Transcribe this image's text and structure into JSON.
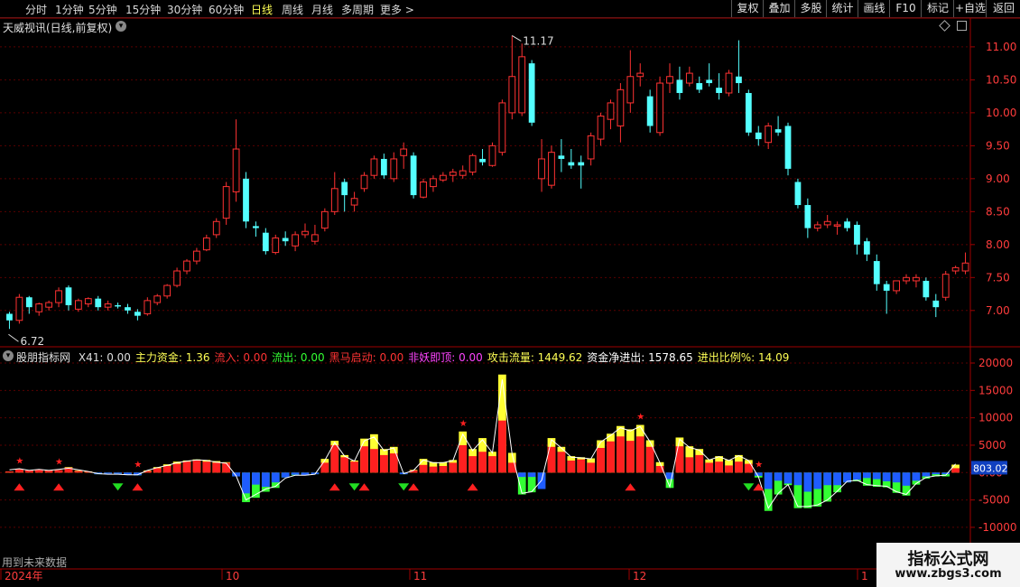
{
  "toolbar": {
    "left_items": [
      "分时",
      "1分钟",
      "5分钟",
      "15分钟",
      "30分钟",
      "60分钟",
      "日线",
      "周线",
      "月线",
      "多周期",
      "更多 >"
    ],
    "active_item": "日线",
    "right_buttons": [
      "复权",
      "叠加",
      "多股",
      "统计",
      "画线",
      "F10",
      "标记",
      "+自选",
      "返回"
    ]
  },
  "main_chart": {
    "title": "天威视讯(日线,前复权)",
    "high_label": "11.17",
    "low_label": "6.72",
    "y_axis": {
      "ticks": [
        11.0,
        10.5,
        10.0,
        9.5,
        9.0,
        8.5,
        8.0,
        7.5,
        7.0
      ]
    }
  },
  "indicator": {
    "name": "股朋指标网",
    "fields": [
      {
        "label": "X41:",
        "value": "0.00",
        "color": "#dddddd"
      },
      {
        "label": "主力资金:",
        "value": "1.36",
        "color": "#ffff55"
      },
      {
        "label": "流入:",
        "value": "0.00",
        "color": "#ff3333"
      },
      {
        "label": "流出:",
        "value": "0.00",
        "color": "#33ff33"
      },
      {
        "label": "黑马启动:",
        "value": "0.00",
        "color": "#ff3333"
      },
      {
        "label": "非妖即顶:",
        "value": "0.00",
        "color": "#ff44ff"
      },
      {
        "label": "攻击流量:",
        "value": "1449.62",
        "color": "#ffff55"
      },
      {
        "label": "资金净进出:",
        "value": "1578.65",
        "color": "#ffffff"
      },
      {
        "label": "进出比例%:",
        "value": "14.09",
        "color": "#ffff55"
      }
    ],
    "y_axis": {
      "ticks": [
        "20000",
        "15000",
        "10000",
        "5000",
        "0.00",
        "-5000",
        "-10000"
      ]
    },
    "current_value": "803.02"
  },
  "x_axis": {
    "labels": [
      "2024年",
      "10",
      "11",
      "12",
      "1"
    ]
  },
  "future_note": "用到未来数据",
  "watermark": {
    "title": "指标公式网",
    "url": "www.zbgs3.com"
  },
  "colors": {
    "up": "#ff3232",
    "down": "#54ffff",
    "grid": "#5a0000",
    "axis": "#a00000"
  },
  "chart_data": [
    {
      "type": "candlestick",
      "title": "天威视讯(日线,前复权)",
      "ylim": [
        6.6,
        11.3
      ],
      "ohlc": [
        [
          6.95,
          6.98,
          6.72,
          6.85
        ],
        [
          6.85,
          7.25,
          6.8,
          7.2
        ],
        [
          7.2,
          7.22,
          6.95,
          7.05
        ],
        [
          6.98,
          7.12,
          6.92,
          7.1
        ],
        [
          7.05,
          7.15,
          7.0,
          7.12
        ],
        [
          7.12,
          7.35,
          7.05,
          7.3
        ],
        [
          7.35,
          7.38,
          7.0,
          7.08
        ],
        [
          7.02,
          7.18,
          6.98,
          7.15
        ],
        [
          7.1,
          7.2,
          7.05,
          7.18
        ],
        [
          7.18,
          7.22,
          7.0,
          7.05
        ],
        [
          7.05,
          7.15,
          7.0,
          7.1
        ],
        [
          7.08,
          7.12,
          7.03,
          7.06
        ],
        [
          7.05,
          7.1,
          6.95,
          7.0
        ],
        [
          6.98,
          7.02,
          6.85,
          6.92
        ],
        [
          6.95,
          7.2,
          6.92,
          7.15
        ],
        [
          7.12,
          7.25,
          7.08,
          7.22
        ],
        [
          7.22,
          7.4,
          7.18,
          7.38
        ],
        [
          7.38,
          7.65,
          7.35,
          7.6
        ],
        [
          7.6,
          7.78,
          7.55,
          7.75
        ],
        [
          7.75,
          7.95,
          7.7,
          7.9
        ],
        [
          7.92,
          8.15,
          7.9,
          8.1
        ],
        [
          8.15,
          8.4,
          8.1,
          8.35
        ],
        [
          8.4,
          8.95,
          8.3,
          8.88
        ],
        [
          8.8,
          9.9,
          8.65,
          9.45
        ],
        [
          9.0,
          9.1,
          8.25,
          8.35
        ],
        [
          8.28,
          8.35,
          8.12,
          8.25
        ],
        [
          8.18,
          8.25,
          7.85,
          7.9
        ],
        [
          7.88,
          8.15,
          7.85,
          8.1
        ],
        [
          8.1,
          8.2,
          7.98,
          8.05
        ],
        [
          7.98,
          8.2,
          7.9,
          8.15
        ],
        [
          8.15,
          8.32,
          8.1,
          8.2
        ],
        [
          8.05,
          8.3,
          8.0,
          8.15
        ],
        [
          8.25,
          8.55,
          8.2,
          8.5
        ],
        [
          8.5,
          9.1,
          8.45,
          8.85
        ],
        [
          8.95,
          9.0,
          8.5,
          8.75
        ],
        [
          8.6,
          8.8,
          8.5,
          8.7
        ],
        [
          8.85,
          9.1,
          8.8,
          9.05
        ],
        [
          9.05,
          9.35,
          9.0,
          9.3
        ],
        [
          9.3,
          9.38,
          9.0,
          9.05
        ],
        [
          9.0,
          9.4,
          8.95,
          9.3
        ],
        [
          9.35,
          9.55,
          9.15,
          9.45
        ],
        [
          9.35,
          9.4,
          8.7,
          8.75
        ],
        [
          8.72,
          9.0,
          8.7,
          8.95
        ],
        [
          8.88,
          9.05,
          8.8,
          9.0
        ],
        [
          8.98,
          9.1,
          8.95,
          9.05
        ],
        [
          9.05,
          9.15,
          8.95,
          9.1
        ],
        [
          9.05,
          9.2,
          9.0,
          9.12
        ],
        [
          9.1,
          9.38,
          9.05,
          9.35
        ],
        [
          9.3,
          9.45,
          9.2,
          9.25
        ],
        [
          9.2,
          9.55,
          9.18,
          9.5
        ],
        [
          9.4,
          10.2,
          9.35,
          10.15
        ],
        [
          10.0,
          11.17,
          9.9,
          10.55
        ],
        [
          10.0,
          11.05,
          9.95,
          10.85
        ],
        [
          10.75,
          10.8,
          9.8,
          9.85
        ],
        [
          9.0,
          9.6,
          8.8,
          9.3
        ],
        [
          8.9,
          9.5,
          8.85,
          9.4
        ],
        [
          9.35,
          9.6,
          9.1,
          9.3
        ],
        [
          9.25,
          9.45,
          9.15,
          9.2
        ],
        [
          9.25,
          9.35,
          8.85,
          9.2
        ],
        [
          9.3,
          9.7,
          9.2,
          9.65
        ],
        [
          9.6,
          10.0,
          9.5,
          9.95
        ],
        [
          9.9,
          10.2,
          9.75,
          10.15
        ],
        [
          9.8,
          10.45,
          9.55,
          10.35
        ],
        [
          10.15,
          10.95,
          10.0,
          10.55
        ],
        [
          10.55,
          10.75,
          10.4,
          10.6
        ],
        [
          10.25,
          10.35,
          9.7,
          9.8
        ],
        [
          9.7,
          10.55,
          9.65,
          10.45
        ],
        [
          10.45,
          10.75,
          10.3,
          10.55
        ],
        [
          10.5,
          10.7,
          10.2,
          10.3
        ],
        [
          10.45,
          10.7,
          10.4,
          10.6
        ],
        [
          10.45,
          10.55,
          10.3,
          10.35
        ],
        [
          10.5,
          10.75,
          10.4,
          10.45
        ],
        [
          10.38,
          10.6,
          10.2,
          10.3
        ],
        [
          10.3,
          10.65,
          10.25,
          10.6
        ],
        [
          10.55,
          11.1,
          10.3,
          10.45
        ],
        [
          10.3,
          10.35,
          9.65,
          9.7
        ],
        [
          9.7,
          9.8,
          9.5,
          9.6
        ],
        [
          9.55,
          9.85,
          9.45,
          9.8
        ],
        [
          9.75,
          9.95,
          9.65,
          9.7
        ],
        [
          9.8,
          9.85,
          9.05,
          9.15
        ],
        [
          8.95,
          9.0,
          8.55,
          8.6
        ],
        [
          8.6,
          8.7,
          8.1,
          8.25
        ],
        [
          8.25,
          8.35,
          8.2,
          8.3
        ],
        [
          8.3,
          8.45,
          8.25,
          8.35
        ],
        [
          8.28,
          8.35,
          8.15,
          8.3
        ],
        [
          8.35,
          8.4,
          8.2,
          8.25
        ],
        [
          8.3,
          8.35,
          7.85,
          8.0
        ],
        [
          8.05,
          8.1,
          7.75,
          7.85
        ],
        [
          7.75,
          7.85,
          7.3,
          7.4
        ],
        [
          7.4,
          7.45,
          6.95,
          7.3
        ],
        [
          7.3,
          7.45,
          7.25,
          7.45
        ],
        [
          7.45,
          7.55,
          7.4,
          7.5
        ],
        [
          7.45,
          7.55,
          7.35,
          7.5
        ],
        [
          7.45,
          7.5,
          7.15,
          7.2
        ],
        [
          7.15,
          7.25,
          6.9,
          7.05
        ],
        [
          7.2,
          7.6,
          7.15,
          7.55
        ],
        [
          7.6,
          7.68,
          7.55,
          7.65
        ],
        [
          7.6,
          7.88,
          7.55,
          7.72
        ]
      ]
    },
    {
      "type": "bar",
      "title": "股朋指标网",
      "ylim": [
        -11000,
        20000
      ],
      "series": [
        {
          "name": "主力资金",
          "values": [
            200,
            600,
            400,
            500,
            350,
            450,
            900,
            300,
            150,
            -300,
            -200,
            -250,
            -350,
            -500,
            300,
            800,
            1200,
            1600,
            2000,
            2200,
            2000,
            1800,
            1800,
            -700,
            -3800,
            -2200,
            -2600,
            -1800,
            -900,
            -400,
            -500,
            -300,
            1800,
            5000,
            2800,
            2000,
            4800,
            4300,
            3200,
            3500,
            -300,
            400,
            1400,
            1100,
            1200,
            1800,
            5000,
            3000,
            3800,
            3000,
            9500,
            1800,
            -800,
            -800,
            -3000,
            4700,
            3800,
            2200,
            2400,
            1800,
            4500,
            5700,
            6600,
            5800,
            6600,
            4700,
            1200,
            -1200,
            4800,
            2800,
            3200,
            1800,
            2000,
            1300,
            2000,
            1600,
            -600,
            -3000,
            -1500,
            -2000,
            -2300,
            -3500,
            -3000,
            -2300,
            -2300,
            -1800,
            -1300,
            -1000,
            -1200,
            -1600,
            -1800,
            -2400,
            -1500,
            -700,
            -300,
            -300,
            800
          ]
        },
        {
          "name": "攻击流量",
          "values": [
            200,
            600,
            400,
            500,
            350,
            450,
            1000,
            400,
            200,
            -300,
            -200,
            -250,
            -350,
            -500,
            400,
            1000,
            1500,
            2000,
            2200,
            2400,
            2300,
            2100,
            1900,
            -700,
            -5400,
            -4600,
            -3500,
            -2800,
            -900,
            -500,
            -500,
            -300,
            2500,
            5800,
            3200,
            2200,
            6200,
            7000,
            4300,
            4700,
            -300,
            500,
            2500,
            1900,
            1900,
            2300,
            7500,
            4300,
            6300,
            3800,
            17900,
            3600,
            -4000,
            -3600,
            -1500,
            6300,
            4700,
            3000,
            2800,
            2600,
            5900,
            7100,
            8500,
            7900,
            8700,
            5900,
            1900,
            -2800,
            6400,
            4800,
            4300,
            2400,
            3000,
            2300,
            3200,
            2300,
            -900,
            -7000,
            -4000,
            -2300,
            -6500,
            -6500,
            -6200,
            -5300,
            -3600,
            -1800,
            -1600,
            -2400,
            -2600,
            -2700,
            -3700,
            -4200,
            -2200,
            -1100,
            -700,
            -700,
            1449.62
          ]
        },
        {
          "name": "资金净进出",
          "values": [
            500,
            700,
            400,
            600,
            400,
            600,
            800,
            500,
            200,
            -200,
            -300,
            -300,
            -400,
            -400,
            400,
            900,
            1300,
            1800,
            2100,
            2300,
            2200,
            1900,
            1700,
            -600,
            -5000,
            -4000,
            -3000,
            -2500,
            -1000,
            -500,
            -500,
            -300,
            2200,
            5500,
            3000,
            2100,
            5800,
            6500,
            4000,
            4500,
            -200,
            400,
            2300,
            1800,
            1800,
            2200,
            7000,
            4000,
            6000,
            3600,
            17000,
            3400,
            -3800,
            -3500,
            -1400,
            6000,
            4500,
            2800,
            2700,
            2500,
            5600,
            6800,
            8200,
            7600,
            8400,
            5600,
            1800,
            -2600,
            6100,
            4600,
            4100,
            2300,
            2900,
            2200,
            3100,
            2200,
            -800,
            -6500,
            -3800,
            -2200,
            -6200,
            -6200,
            -5900,
            -5000,
            -3400,
            -1600,
            -1400,
            -2200,
            -2400,
            -2500,
            -3500,
            -4000,
            -2000,
            -900,
            -600,
            -500,
            1578.65
          ]
        }
      ],
      "up_markers": [
        1,
        5,
        13,
        33,
        36,
        41,
        47,
        63,
        76
      ],
      "down_markers": [
        11,
        35,
        40,
        75
      ],
      "star_markers": [
        1,
        5,
        13,
        46,
        64,
        76
      ]
    }
  ]
}
